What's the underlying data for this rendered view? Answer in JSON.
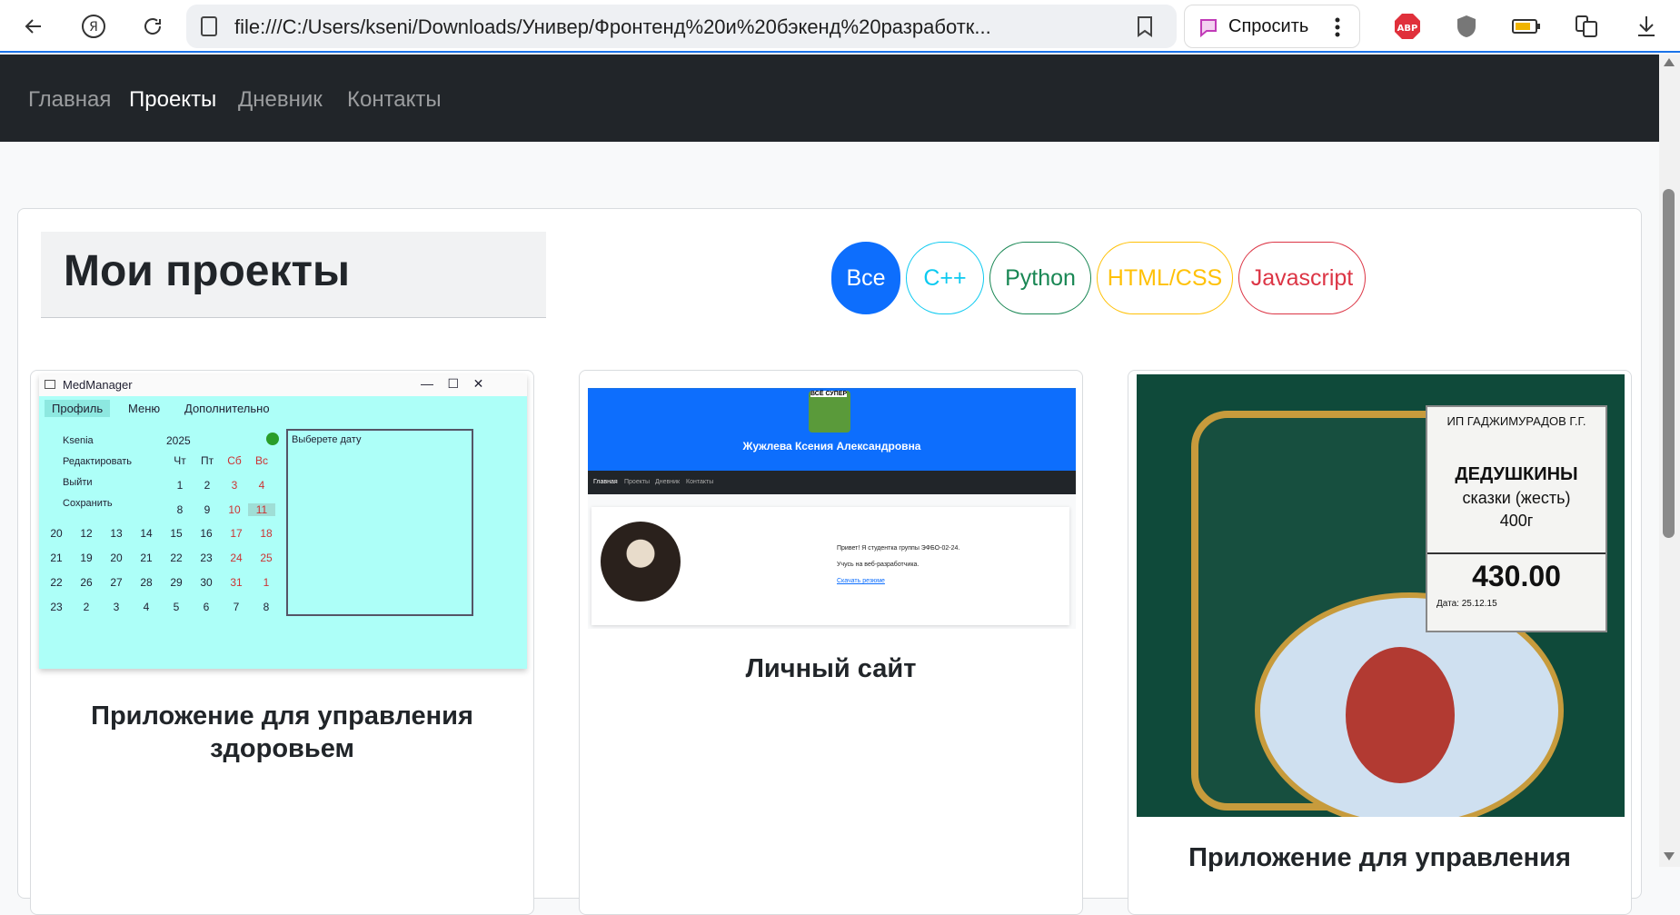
{
  "browser": {
    "url": "file:///C:/Users/kseni/Downloads/Универ/Фронтенд%20и%20бэкенд%20разработк...",
    "ask_label": "Спросить"
  },
  "nav": {
    "items": [
      {
        "label": "Главная"
      },
      {
        "label": "Проекты"
      },
      {
        "label": "Дневник"
      },
      {
        "label": "Контакты"
      }
    ]
  },
  "page": {
    "title": "Мои проекты",
    "filters": [
      {
        "label": "Все",
        "color": "#0d6efd"
      },
      {
        "label": "C++",
        "color": "#0dcaf0"
      },
      {
        "label": "Python",
        "color": "#198754"
      },
      {
        "label": "HTML/CSS",
        "color": "#ffc107"
      },
      {
        "label": "Javascript",
        "color": "#dc3545"
      }
    ]
  },
  "cards": [
    {
      "title": "Приложение для управления здоровьем",
      "shot": {
        "window_title": "MedManager",
        "menu": [
          "Профиль",
          "Меню",
          "Дополнительно"
        ],
        "actions": [
          "Ksenia",
          "Редактировать",
          "Выйти",
          "Сохранить"
        ],
        "year": "2025",
        "weekdays": [
          "Чт",
          "Пт",
          "Сб",
          "Вс"
        ],
        "date_placeholder": "Выберете дату",
        "row1": [
          "1",
          "2",
          "3",
          "4"
        ],
        "row2": [
          "8",
          "9",
          "10",
          "11"
        ],
        "rows": [
          [
            "20",
            "12",
            "13",
            "14",
            "15",
            "16",
            "17",
            "18"
          ],
          [
            "21",
            "19",
            "20",
            "21",
            "22",
            "23",
            "24",
            "25"
          ],
          [
            "22",
            "26",
            "27",
            "28",
            "29",
            "30",
            "31",
            "1"
          ],
          [
            "23",
            "2",
            "3",
            "4",
            "5",
            "6",
            "7",
            "8"
          ]
        ]
      }
    },
    {
      "title": "Личный сайт",
      "shot": {
        "badge": "ВСЁ СУПЕР",
        "name": "Жужлева Ксения Александровна",
        "nav": [
          "Главная",
          "Проекты",
          "Дневник",
          "Контакты"
        ],
        "greeting": "Привет! Я студентка группы ЭФБО-02-24.",
        "study": "Учусь на веб-разработчика.",
        "resume_link": "Скачать резюме"
      }
    },
    {
      "title": "Приложение для управления",
      "shot": {
        "seller": "ИП ГАДЖИМУРАДОВ Г.Г.",
        "product_line1": "ДЕДУШКИНЫ",
        "product_line2": "сказки (жесть)",
        "weight": "400г",
        "price": "430.00",
        "date": "Дата: 25.12.15"
      }
    }
  ]
}
